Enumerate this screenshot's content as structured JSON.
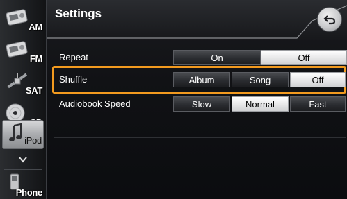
{
  "header": {
    "title": "Settings",
    "back_icon": "back-arrow-icon"
  },
  "sidebar": {
    "items": [
      {
        "label": "AM",
        "icon": "radio-am-icon"
      },
      {
        "label": "FM",
        "icon": "radio-fm-icon"
      },
      {
        "label": "SAT",
        "icon": "satellite-icon"
      },
      {
        "label": "CD",
        "icon": "cd-icon"
      },
      {
        "label": "iPod",
        "icon": "ipod-music-icon",
        "active": true
      },
      {
        "label": "Phone",
        "icon": "phone-icon"
      }
    ],
    "more_icon": "chevron-down-icon"
  },
  "settings": {
    "repeat": {
      "label": "Repeat",
      "options": [
        "On",
        "Off"
      ],
      "selected": "Off"
    },
    "shuffle": {
      "label": "Shuffle",
      "options": [
        "Album",
        "Song",
        "Off"
      ],
      "selected": "Off"
    },
    "audiobook_speed": {
      "label": "Audiobook Speed",
      "options": [
        "Slow",
        "Normal",
        "Fast"
      ],
      "selected": "Normal"
    }
  },
  "colors": {
    "highlight": "#f29a1f",
    "selected_option_bg": "#e9e9ea",
    "background": "#0b0c10"
  }
}
